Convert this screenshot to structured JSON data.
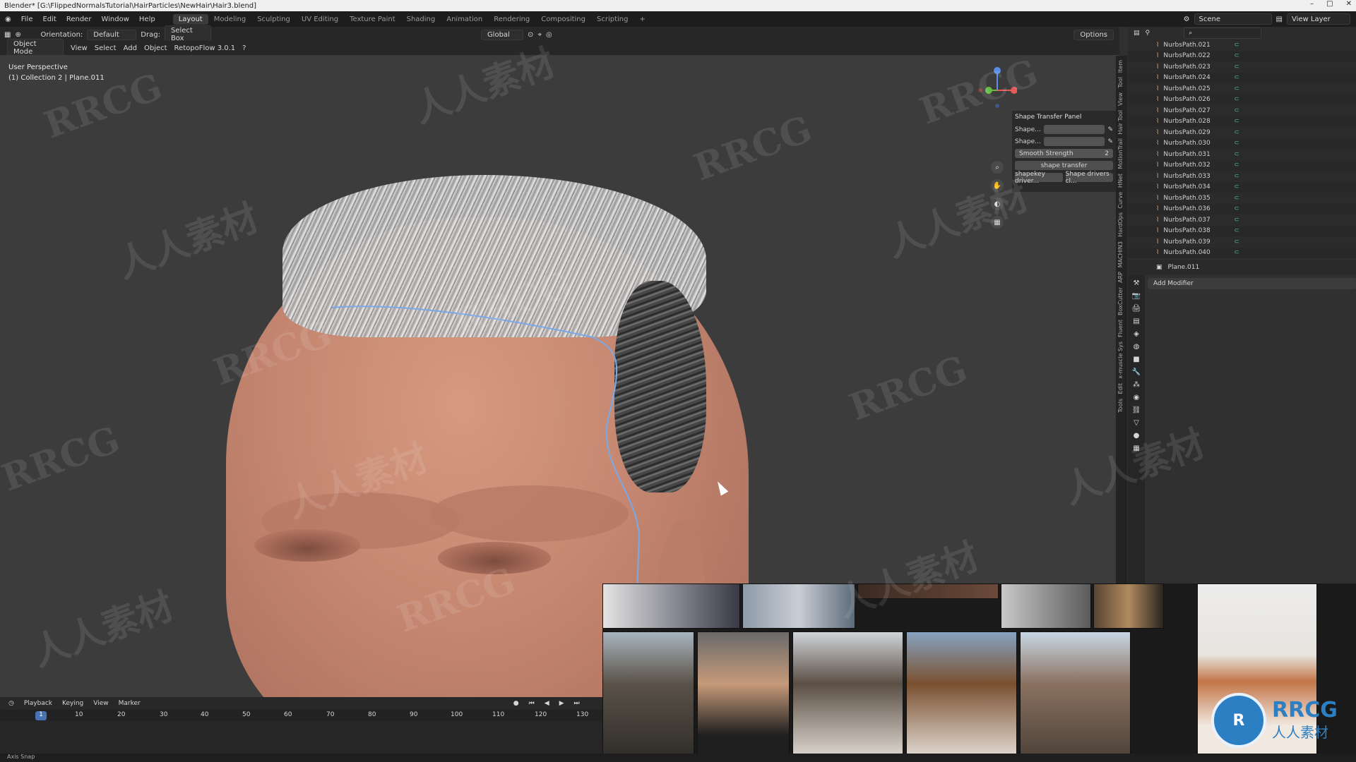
{
  "window": {
    "title": "Blender* [G:\\FlippedNormalsTutorial\\HairParticles\\NewHair\\Hair3.blend]"
  },
  "menu": {
    "items": [
      "File",
      "Edit",
      "Render",
      "Window",
      "Help"
    ]
  },
  "workspaces": [
    "Layout",
    "Modeling",
    "Sculpting",
    "UV Editing",
    "Texture Paint",
    "Shading",
    "Animation",
    "Rendering",
    "Compositing",
    "Scripting"
  ],
  "topright": {
    "scene": "Scene",
    "view_layer": "View Layer"
  },
  "viewport_header": {
    "orientation_label": "Orientation:",
    "orientation_value": "Default",
    "drag_label": "Drag:",
    "drag_value": "Select Box",
    "transform": "Global",
    "options": "Options"
  },
  "viewport_header2": {
    "mode": "Object Mode",
    "items": [
      "View",
      "Select",
      "Add",
      "Object"
    ],
    "addon": "RetopoFlow 3.0.1"
  },
  "viewport": {
    "perspective": "User Perspective",
    "collection": "(1) Collection 2 | Plane.011"
  },
  "npanel": {
    "title": "Shape Transfer Panel",
    "shape1": "Shape...",
    "shape2": "Shape...",
    "smooth_label": "Smooth Strength",
    "smooth_value": "2",
    "transfer_btn": "shape transfer",
    "driver_btn": "shapekey driver...",
    "drivers_clear": "Shape drivers cl..."
  },
  "side_tabs": [
    "Item",
    "Tool",
    "View",
    "Hair Tool",
    "MotionTrail",
    "HNet",
    "Curve",
    "HardOps",
    "MACHIN3",
    "ARP",
    "BoxCutter",
    "Fluent",
    "x-muscle Sys",
    "Edit",
    "Tools"
  ],
  "outliner": {
    "items": [
      "NurbsPath.021",
      "NurbsPath.022",
      "NurbsPath.023",
      "NurbsPath.024",
      "NurbsPath.025",
      "NurbsPath.026",
      "NurbsPath.027",
      "NurbsPath.028",
      "NurbsPath.029",
      "NurbsPath.030",
      "NurbsPath.031",
      "NurbsPath.032",
      "NurbsPath.033",
      "NurbsPath.034",
      "NurbsPath.035",
      "NurbsPath.036",
      "NurbsPath.037",
      "NurbsPath.038",
      "NurbsPath.039",
      "NurbsPath.040"
    ]
  },
  "properties": {
    "object": "Plane.011",
    "add_modifier": "Add Modifier"
  },
  "timeline": {
    "menu": [
      "Playback",
      "Keying",
      "View",
      "Marker"
    ],
    "current_frame": "1",
    "ticks": [
      "10",
      "20",
      "30",
      "40",
      "50",
      "60",
      "70",
      "80",
      "90",
      "100",
      "110",
      "120",
      "130"
    ]
  },
  "status": {
    "text": "Axis Snap"
  },
  "watermark": {
    "logo_text": "RRCG",
    "logo_sub": "人人素材"
  }
}
